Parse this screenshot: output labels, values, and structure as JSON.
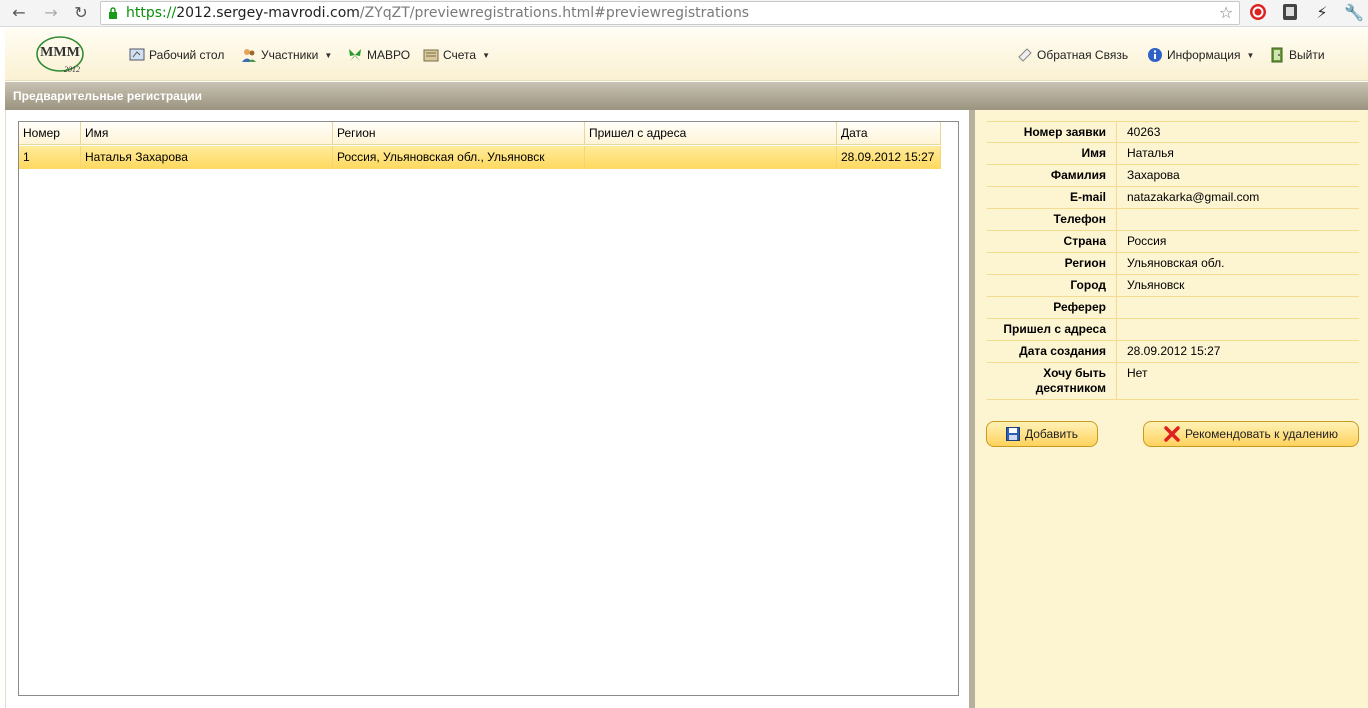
{
  "browser": {
    "url_scheme": "https://",
    "url_host": "2012.sergey-mavrodi.com",
    "url_path": "/ZYqZT/previewregistrations.html#previewregistrations",
    "back_icon": "back-arrow-icon",
    "forward_icon": "forward-arrow-icon",
    "reload_icon": "reload-icon"
  },
  "header": {
    "logo_text": "MMM",
    "logo_year": "2012",
    "menu": [
      {
        "label": "Рабочий стол",
        "icon": "desktop-icon"
      },
      {
        "label": "Участники",
        "icon": "people-icon",
        "dropdown": true
      },
      {
        "label": "МАВРО",
        "icon": "butterfly-icon"
      },
      {
        "label": "Счета",
        "icon": "accounts-icon",
        "dropdown": true
      }
    ],
    "right_menu": [
      {
        "label": "Обратная Связь",
        "icon": "feedback-icon"
      },
      {
        "label": "Информация",
        "icon": "info-icon",
        "dropdown": true
      },
      {
        "label": "Выйти",
        "icon": "exit-icon"
      }
    ]
  },
  "page": {
    "title": "Предварительные регистрации"
  },
  "grid": {
    "columns": [
      "Номер",
      "Имя",
      "Регион",
      "Пришел с адреса",
      "Дата"
    ],
    "rows": [
      [
        "1",
        "Наталья Захарова",
        "Россия, Ульяновская обл., Ульяновск",
        "",
        "28.09.2012 15:27"
      ]
    ]
  },
  "details": {
    "fields": [
      {
        "label": "Номер заявки",
        "value": "40263"
      },
      {
        "label": "Имя",
        "value": "Наталья"
      },
      {
        "label": "Фамилия",
        "value": "Захарова"
      },
      {
        "label": "E-mail",
        "value": "natazakarka@gmail.com"
      },
      {
        "label": "Телефон",
        "value": ""
      },
      {
        "label": "Страна",
        "value": "Россия"
      },
      {
        "label": "Регион",
        "value": "Ульяновская обл."
      },
      {
        "label": "Город",
        "value": "Ульяновск"
      },
      {
        "label": "Реферер",
        "value": ""
      },
      {
        "label": "Пришел с адреса",
        "value": ""
      },
      {
        "label": "Дата создания",
        "value": "28.09.2012 15:27"
      },
      {
        "label": "Хочу быть десятником",
        "value": "Нет"
      }
    ],
    "add_button": "Добавить",
    "delete_button": "Рекомендовать к удалению"
  },
  "colors": {
    "accent": "#ffd95f",
    "panel_bg": "#fdf4d2",
    "titlebar": "#9a937f"
  }
}
